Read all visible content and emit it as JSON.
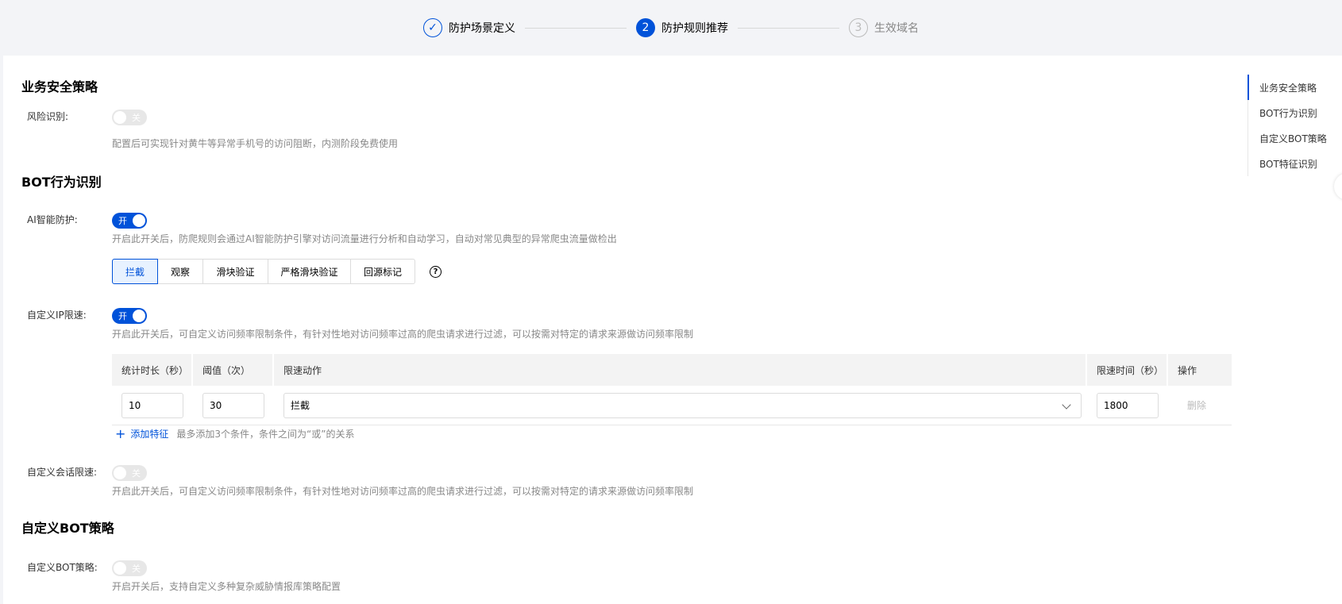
{
  "steps": [
    {
      "num": "✓",
      "label": "防护场景定义",
      "state": "done"
    },
    {
      "num": "2",
      "label": "防护规则推荐",
      "state": "active"
    },
    {
      "num": "3",
      "label": "生效域名",
      "state": "todo"
    }
  ],
  "sections": {
    "business": {
      "title": "业务安全策略",
      "risk_label": "风险识别:",
      "risk_toggle": "关",
      "risk_desc": "配置后可实现针对黄牛等异常手机号的访问阻断，内测阶段免费使用"
    },
    "bot": {
      "title": "BOT行为识别",
      "ai_label": "AI智能防护:",
      "ai_toggle": "开",
      "ai_desc": "开启此开关后，防爬规则会通过AI智能防护引擎对访问流量进行分析和自动学习，自动对常见典型的异常爬虫流量做检出",
      "actions": [
        "拦截",
        "观察",
        "滑块验证",
        "严格滑块验证",
        "回源标记"
      ],
      "help": "?",
      "ip_label": "自定义IP限速:",
      "ip_toggle": "开",
      "ip_desc": "开启此开关后，可自定义访问频率限制条件，有针对性地对访问频率过高的爬虫请求进行过滤，可以按需对特定的请求来源做访问频率限制",
      "table": {
        "headers": [
          "统计时长（秒）",
          "阈值（次）",
          "限速动作",
          "限速时间（秒）",
          "操作"
        ],
        "row": {
          "duration": "10",
          "threshold": "30",
          "action": "拦截",
          "limit_time": "1800",
          "op": "删除"
        }
      },
      "add_label": "添加特征",
      "add_hint": "最多添加3个条件，条件之间为“或”的关系",
      "session_label": "自定义会话限速:",
      "session_toggle": "关",
      "session_desc": "开启此开关后，可自定义访问频率限制条件，有针对性地对访问频率过高的爬虫请求进行过滤，可以按需对特定的请求来源做访问频率限制"
    },
    "custom_bot": {
      "title": "自定义BOT策略",
      "label": "自定义BOT策略:",
      "toggle": "关",
      "desc": "开启开关后，支持自定义多种复杂威胁情报库策略配置"
    }
  },
  "anchor_nav": [
    "业务安全策略",
    "BOT行为识别",
    "自定义BOT策略",
    "BOT特征识别"
  ],
  "colors": {
    "primary": "#0052d9",
    "toggle_off": "#e7e7e7"
  }
}
